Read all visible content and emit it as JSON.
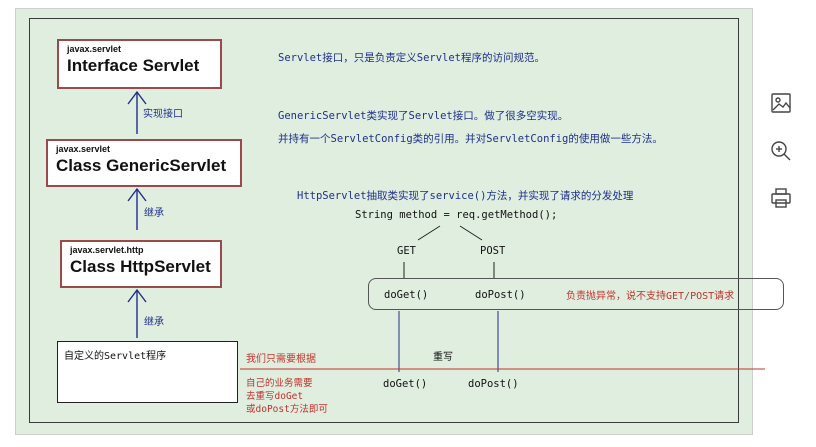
{
  "classes": {
    "servlet": {
      "package": "javax.servlet",
      "name": "Interface Servlet"
    },
    "generic": {
      "package": "javax.servlet",
      "name": "Class GenericServlet"
    },
    "http": {
      "package": "javax.servlet.http",
      "name": "Class HttpServlet"
    }
  },
  "arrows": {
    "implements": "实现接口",
    "extends_1": "继承",
    "extends_2": "继承"
  },
  "notes": {
    "servlet": "Servlet接口，只是负责定义Servlet程序的访问规范。",
    "generic_1": "GenericServlet类实现了Servlet接口。做了很多空实现。",
    "generic_2": "并持有一个ServletConfig类的引用。并对ServletConfig的使用做一些方法。",
    "http": "HttpServlet抽取类实现了service()方法，并实现了请求的分发处理",
    "code": "String method = req.getMethod();"
  },
  "dispatch": {
    "get": "GET",
    "post": "POST",
    "doget": "doGet()",
    "dopost": "doPost()",
    "error_note": "负责抛异常，说不支持GET/POST请求",
    "override": "重写",
    "child_doget": "doGet()",
    "child_dopost": "doPost()"
  },
  "custom": {
    "label": "自定义的Servlet程序",
    "need": "我们只需要根据",
    "steps": [
      "自己的业务需要",
      "去重写doGet",
      "或doPost方法即可"
    ]
  },
  "toolbar": {
    "image_icon": "image-icon",
    "zoom_icon": "zoom-in-icon",
    "print_icon": "print-icon"
  },
  "colors": {
    "background": "#e0eee0",
    "box_border": "#9a4a4a",
    "note_blue": "#1f2f8a",
    "note_red": "#c0332b",
    "arrow": "#1f2f8a"
  }
}
